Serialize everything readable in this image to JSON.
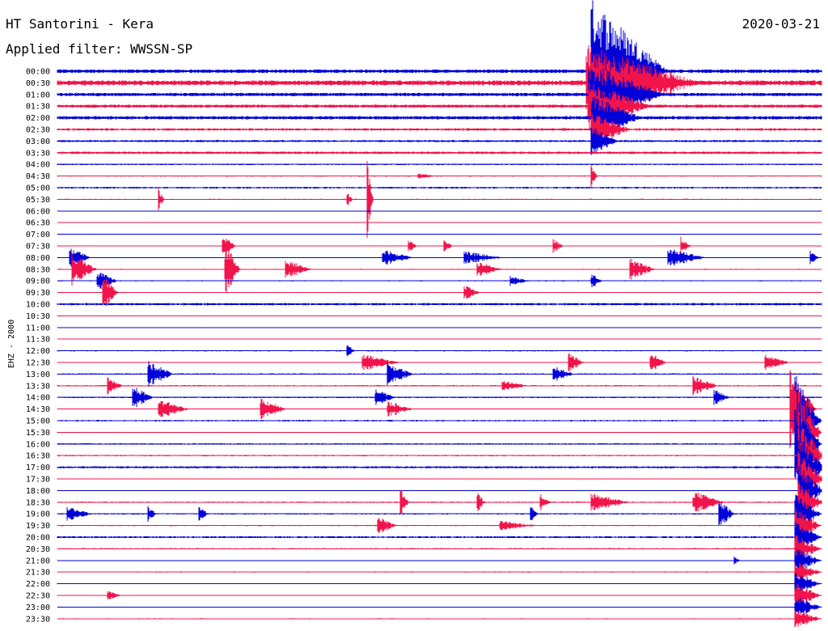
{
  "header": {
    "station": "HT Santorini - Kera",
    "filter": "Applied filter: WWSSN-SP",
    "date": "2020-03-21"
  },
  "colors": {
    "blue": "#0000d8",
    "red": "#f0144a",
    "text": "#000000"
  },
  "chart_data": {
    "type": "line",
    "title": "HT Santorini - Kera",
    "subtitle": "Applied filter: WWSSN-SP",
    "date": "2020-03-21",
    "ylabel": "EHZ - 2000",
    "rows": [
      "00:00",
      "00:30",
      "01:00",
      "01:30",
      "02:00",
      "02:30",
      "03:00",
      "03:30",
      "04:00",
      "04:30",
      "05:00",
      "05:30",
      "06:00",
      "06:30",
      "07:00",
      "07:30",
      "08:00",
      "08:30",
      "09:00",
      "09:30",
      "10:00",
      "10:30",
      "11:00",
      "11:30",
      "12:00",
      "12:30",
      "13:00",
      "13:30",
      "14:00",
      "14:30",
      "15:00",
      "15:30",
      "16:00",
      "16:30",
      "17:00",
      "17:30",
      "18:00",
      "18:30",
      "19:00",
      "19:30",
      "20:00",
      "20:30",
      "21:00",
      "21:30",
      "22:00",
      "22:30",
      "23:00",
      "23:30"
    ],
    "row_colors": [
      "blue",
      "red"
    ],
    "row_duration_minutes": 30,
    "noise_level": [
      1.6,
      2.2,
      1.5,
      1.4,
      1.5,
      1.0,
      0.9,
      1.1,
      0.6,
      0.5,
      0.7,
      0.5,
      0.2,
      0.3,
      0.3,
      0.3,
      0.4,
      0.4,
      0.4,
      0.3,
      1.0,
      0.3,
      0.3,
      0.3,
      0.5,
      0.4,
      0.6,
      0.5,
      0.6,
      0.3,
      0.6,
      0.4,
      0.6,
      0.5,
      0.9,
      0.5,
      0.4,
      0.5,
      0.5,
      0.5,
      0.8,
      0.6,
      0.3,
      0.4,
      0.4,
      0.5,
      0.3,
      0.4
    ],
    "events": [
      {
        "row": "00:00",
        "minute": 21.0,
        "amplitude": 90,
        "duration": 3.0
      },
      {
        "row": "00:30",
        "minute": 20.8,
        "amplitude": 48,
        "duration": 4.5
      },
      {
        "row": "01:00",
        "minute": 20.9,
        "amplitude": 40,
        "duration": 3.0
      },
      {
        "row": "01:30",
        "minute": 20.9,
        "amplitude": 30,
        "duration": 2.5
      },
      {
        "row": "02:00",
        "minute": 21.0,
        "amplitude": 28,
        "duration": 2.0
      },
      {
        "row": "02:30",
        "minute": 21.0,
        "amplitude": 24,
        "duration": 1.5
      },
      {
        "row": "03:00",
        "minute": 21.0,
        "amplitude": 20,
        "duration": 1.0
      },
      {
        "row": "04:30",
        "minute": 21.0,
        "amplitude": 12,
        "duration": 0.2
      },
      {
        "row": "04:30",
        "minute": 14.2,
        "amplitude": 3,
        "duration": 0.8
      },
      {
        "row": "05:30",
        "minute": 4.0,
        "amplitude": 12,
        "duration": 0.2
      },
      {
        "row": "05:30",
        "minute": 11.4,
        "amplitude": 8,
        "duration": 0.2
      },
      {
        "row": "05:30",
        "minute": 12.2,
        "amplitude": 42,
        "duration": 0.2
      },
      {
        "row": "07:30",
        "minute": 6.5,
        "amplitude": 14,
        "duration": 0.5
      },
      {
        "row": "07:30",
        "minute": 13.8,
        "amplitude": 10,
        "duration": 0.3
      },
      {
        "row": "07:30",
        "minute": 15.2,
        "amplitude": 9,
        "duration": 0.3
      },
      {
        "row": "07:30",
        "minute": 19.5,
        "amplitude": 8,
        "duration": 0.4
      },
      {
        "row": "07:30",
        "minute": 24.5,
        "amplitude": 11,
        "duration": 0.4
      },
      {
        "row": "08:00",
        "minute": 0.5,
        "amplitude": 14,
        "duration": 0.8
      },
      {
        "row": "08:00",
        "minute": 12.8,
        "amplitude": 10,
        "duration": 1.2
      },
      {
        "row": "08:00",
        "minute": 16.0,
        "amplitude": 8,
        "duration": 1.5
      },
      {
        "row": "08:00",
        "minute": 24.0,
        "amplitude": 12,
        "duration": 1.5
      },
      {
        "row": "08:00",
        "minute": 29.6,
        "amplitude": 9,
        "duration": 0.3
      },
      {
        "row": "08:30",
        "minute": 0.6,
        "amplitude": 20,
        "duration": 1.0
      },
      {
        "row": "08:30",
        "minute": 6.6,
        "amplitude": 32,
        "duration": 0.6
      },
      {
        "row": "08:30",
        "minute": 9.0,
        "amplitude": 12,
        "duration": 1.0
      },
      {
        "row": "08:30",
        "minute": 16.5,
        "amplitude": 10,
        "duration": 1.0
      },
      {
        "row": "08:30",
        "minute": 22.5,
        "amplitude": 14,
        "duration": 1.0
      },
      {
        "row": "09:00",
        "minute": 1.6,
        "amplitude": 12,
        "duration": 0.8
      },
      {
        "row": "09:00",
        "minute": 17.8,
        "amplitude": 6,
        "duration": 0.8
      },
      {
        "row": "09:00",
        "minute": 21.0,
        "amplitude": 9,
        "duration": 0.4
      },
      {
        "row": "09:30",
        "minute": 1.8,
        "amplitude": 22,
        "duration": 0.6
      },
      {
        "row": "09:30",
        "minute": 16.0,
        "amplitude": 10,
        "duration": 0.6
      },
      {
        "row": "12:00",
        "minute": 11.4,
        "amplitude": 8,
        "duration": 0.3
      },
      {
        "row": "12:30",
        "minute": 12.0,
        "amplitude": 10,
        "duration": 1.5
      },
      {
        "row": "12:30",
        "minute": 20.1,
        "amplitude": 12,
        "duration": 0.6
      },
      {
        "row": "12:30",
        "minute": 23.3,
        "amplitude": 14,
        "duration": 0.6
      },
      {
        "row": "12:30",
        "minute": 27.8,
        "amplitude": 10,
        "duration": 1.0
      },
      {
        "row": "13:00",
        "minute": 3.6,
        "amplitude": 16,
        "duration": 1.0
      },
      {
        "row": "13:00",
        "minute": 13.0,
        "amplitude": 14,
        "duration": 1.0
      },
      {
        "row": "13:00",
        "minute": 19.5,
        "amplitude": 10,
        "duration": 0.8
      },
      {
        "row": "13:30",
        "minute": 2.0,
        "amplitude": 10,
        "duration": 0.6
      },
      {
        "row": "13:30",
        "minute": 17.5,
        "amplitude": 8,
        "duration": 1.0
      },
      {
        "row": "13:30",
        "minute": 25.0,
        "amplitude": 12,
        "duration": 1.0
      },
      {
        "row": "14:00",
        "minute": 3.0,
        "amplitude": 14,
        "duration": 0.8
      },
      {
        "row": "14:00",
        "minute": 12.5,
        "amplitude": 10,
        "duration": 0.8
      },
      {
        "row": "14:00",
        "minute": 25.8,
        "amplitude": 10,
        "duration": 0.6
      },
      {
        "row": "14:30",
        "minute": 4.0,
        "amplitude": 12,
        "duration": 1.2
      },
      {
        "row": "14:30",
        "minute": 8.0,
        "amplitude": 14,
        "duration": 1.0
      },
      {
        "row": "14:30",
        "minute": 13.0,
        "amplitude": 10,
        "duration": 1.0
      },
      {
        "row": "14:30",
        "minute": 28.8,
        "amplitude": 48,
        "duration": 1.0
      },
      {
        "row": "15:00",
        "minute": 29.0,
        "amplitude": 60,
        "duration": 1.0
      },
      {
        "row": "15:30",
        "minute": 29.0,
        "amplitude": 58,
        "duration": 1.0
      },
      {
        "row": "16:00",
        "minute": 29.0,
        "amplitude": 52,
        "duration": 1.0
      },
      {
        "row": "16:30",
        "minute": 29.1,
        "amplitude": 46,
        "duration": 1.0
      },
      {
        "row": "17:00",
        "minute": 29.1,
        "amplitude": 40,
        "duration": 1.0
      },
      {
        "row": "17:30",
        "minute": 29.1,
        "amplitude": 36,
        "duration": 1.0
      },
      {
        "row": "18:00",
        "minute": 29.1,
        "amplitude": 32,
        "duration": 1.0
      },
      {
        "row": "18:30",
        "minute": 29.1,
        "amplitude": 28,
        "duration": 1.0
      },
      {
        "row": "18:30",
        "minute": 13.5,
        "amplitude": 16,
        "duration": 0.3
      },
      {
        "row": "18:30",
        "minute": 16.5,
        "amplitude": 12,
        "duration": 0.3
      },
      {
        "row": "18:30",
        "minute": 19.0,
        "amplitude": 10,
        "duration": 0.4
      },
      {
        "row": "18:30",
        "minute": 21.0,
        "amplitude": 12,
        "duration": 1.5
      },
      {
        "row": "18:30",
        "minute": 25.0,
        "amplitude": 14,
        "duration": 1.2
      },
      {
        "row": "19:00",
        "minute": 0.4,
        "amplitude": 10,
        "duration": 1.0
      },
      {
        "row": "19:00",
        "minute": 3.6,
        "amplitude": 9,
        "duration": 0.3
      },
      {
        "row": "19:00",
        "minute": 5.6,
        "amplitude": 12,
        "duration": 0.3
      },
      {
        "row": "19:00",
        "minute": 18.6,
        "amplitude": 10,
        "duration": 0.3
      },
      {
        "row": "19:00",
        "minute": 26.0,
        "amplitude": 18,
        "duration": 0.6
      },
      {
        "row": "19:00",
        "minute": 29.0,
        "amplitude": 24,
        "duration": 1.0
      },
      {
        "row": "19:30",
        "minute": 12.6,
        "amplitude": 10,
        "duration": 0.8
      },
      {
        "row": "19:30",
        "minute": 17.4,
        "amplitude": 6,
        "duration": 1.5
      },
      {
        "row": "19:30",
        "minute": 29.0,
        "amplitude": 22,
        "duration": 1.0
      },
      {
        "row": "20:00",
        "minute": 29.0,
        "amplitude": 20,
        "duration": 1.0
      },
      {
        "row": "20:30",
        "minute": 29.0,
        "amplitude": 18,
        "duration": 1.0
      },
      {
        "row": "21:00",
        "minute": 26.6,
        "amplitude": 5,
        "duration": 0.2
      },
      {
        "row": "21:00",
        "minute": 29.0,
        "amplitude": 16,
        "duration": 1.0
      },
      {
        "row": "21:30",
        "minute": 29.0,
        "amplitude": 14,
        "duration": 1.0
      },
      {
        "row": "22:00",
        "minute": 29.0,
        "amplitude": 14,
        "duration": 1.0
      },
      {
        "row": "22:30",
        "minute": 2.0,
        "amplitude": 6,
        "duration": 0.5
      },
      {
        "row": "22:30",
        "minute": 29.0,
        "amplitude": 16,
        "duration": 1.0
      },
      {
        "row": "23:00",
        "minute": 29.0,
        "amplitude": 14,
        "duration": 1.0
      },
      {
        "row": "23:30",
        "minute": 29.0,
        "amplitude": 12,
        "duration": 1.0
      }
    ]
  }
}
